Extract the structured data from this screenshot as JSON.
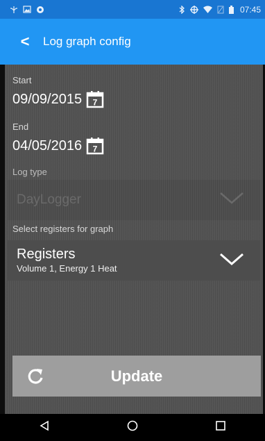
{
  "status_bar": {
    "time": "07:45",
    "icons": [
      "usb-icon",
      "image-icon",
      "sync-icon",
      "bluetooth-icon",
      "data-transfer-icon",
      "wifi-icon",
      "no-sim-icon",
      "battery-icon"
    ],
    "background": "#1976d2"
  },
  "app_bar": {
    "back_glyph": "<",
    "title": "Log graph config",
    "background": "#2196f3"
  },
  "form": {
    "start_label": "Start",
    "start_date": "09/09/2015",
    "end_label": "End",
    "end_date": "04/05/2016",
    "calendar_day": "7",
    "log_type_label": "Log type",
    "log_type_value": "DayLogger",
    "registers_label": "Select registers for graph",
    "registers_title": "Registers",
    "registers_selected": "Volume 1, Energy 1 Heat"
  },
  "update_button": {
    "label": "Update",
    "background": "#9e9e9e"
  },
  "nav_bar": {
    "icons": [
      "back-triangle-icon",
      "home-circle-icon",
      "recents-square-icon"
    ]
  }
}
